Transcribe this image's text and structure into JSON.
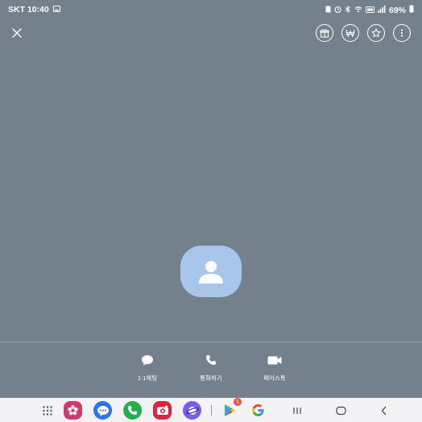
{
  "status_bar": {
    "carrier_time": "SKT 10:40",
    "battery": "69%",
    "icons": [
      "gallery-icon",
      "screenshot-icon",
      "alarm-icon",
      "bluetooth-icon",
      "wifi-icon",
      "lte-icon",
      "signal-icon",
      "battery-icon"
    ]
  },
  "top_bar": {
    "close_icon": "close-icon",
    "actions": [
      "gift-icon",
      "won-currency-icon",
      "star-icon",
      "more-vertical-icon"
    ]
  },
  "profile": {
    "avatar_icon": "default-person-icon"
  },
  "actions": [
    {
      "label": "1:1채팅",
      "icon": "chat-bubble-icon"
    },
    {
      "label": "통화하기",
      "icon": "phone-icon"
    },
    {
      "label": "페이스톡",
      "icon": "video-camera-icon"
    }
  ],
  "nav_bar": {
    "apps": [
      "app-drawer-icon",
      "flower-app-icon",
      "messages-icon",
      "phone-app-icon",
      "camera-app-icon",
      "internet-icon",
      "play-store-icon",
      "google-icon"
    ],
    "play_store_badge": "1",
    "buttons": [
      "recent-apps-icon",
      "home-icon",
      "back-icon"
    ]
  },
  "colors": {
    "background": "#74818d",
    "avatar": "#a7c6ea",
    "nav_bar": "#f3f3f5"
  }
}
